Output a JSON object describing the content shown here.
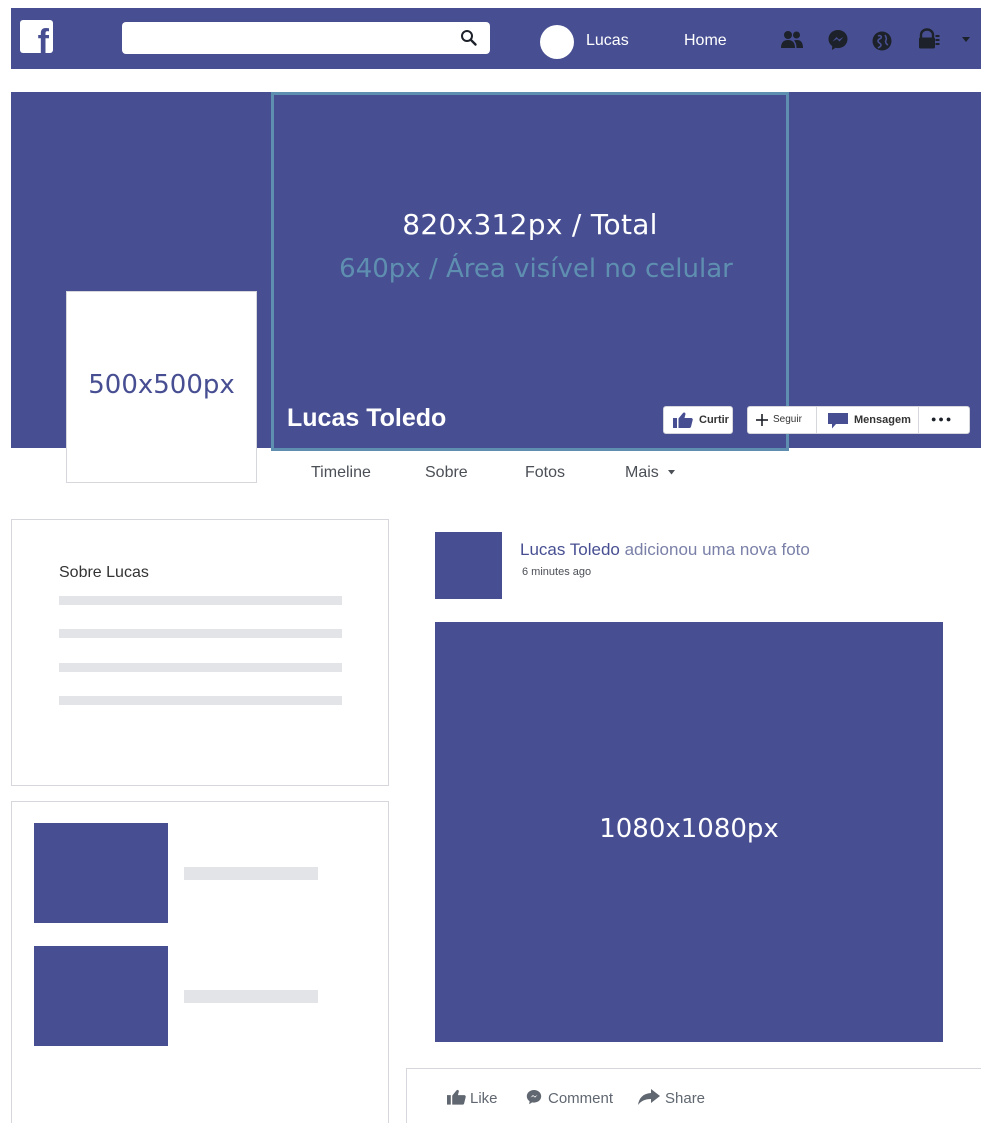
{
  "nav": {
    "search_placeholder": "",
    "user_name": "Lucas",
    "home_label": "Home"
  },
  "cover": {
    "size_label": "820x312px / Total",
    "mobile_label": "640px / Área visível no celular",
    "profile_photo_label": "500x500px",
    "profile_name": "Lucas Toledo",
    "buttons": {
      "like": "Curtir",
      "follow": "Seguir",
      "message": "Mensagem",
      "more": "●●●"
    }
  },
  "tabs": {
    "timeline": "Timeline",
    "about": "Sobre",
    "photos": "Fotos",
    "more": "Mais"
  },
  "about_card": {
    "title": "Sobre Lucas"
  },
  "post": {
    "author": "Lucas Toledo",
    "action_text": " adicionou uma nova foto",
    "time": "6 minutes ago",
    "image_label": "1080x1080px",
    "actions": {
      "like": "Like",
      "comment": "Comment",
      "share": "Share"
    }
  },
  "colors": {
    "brand": "#474f92",
    "frame": "#5f8fb0",
    "placeholder": "#e3e4e8",
    "border": "#d5d7dd"
  }
}
